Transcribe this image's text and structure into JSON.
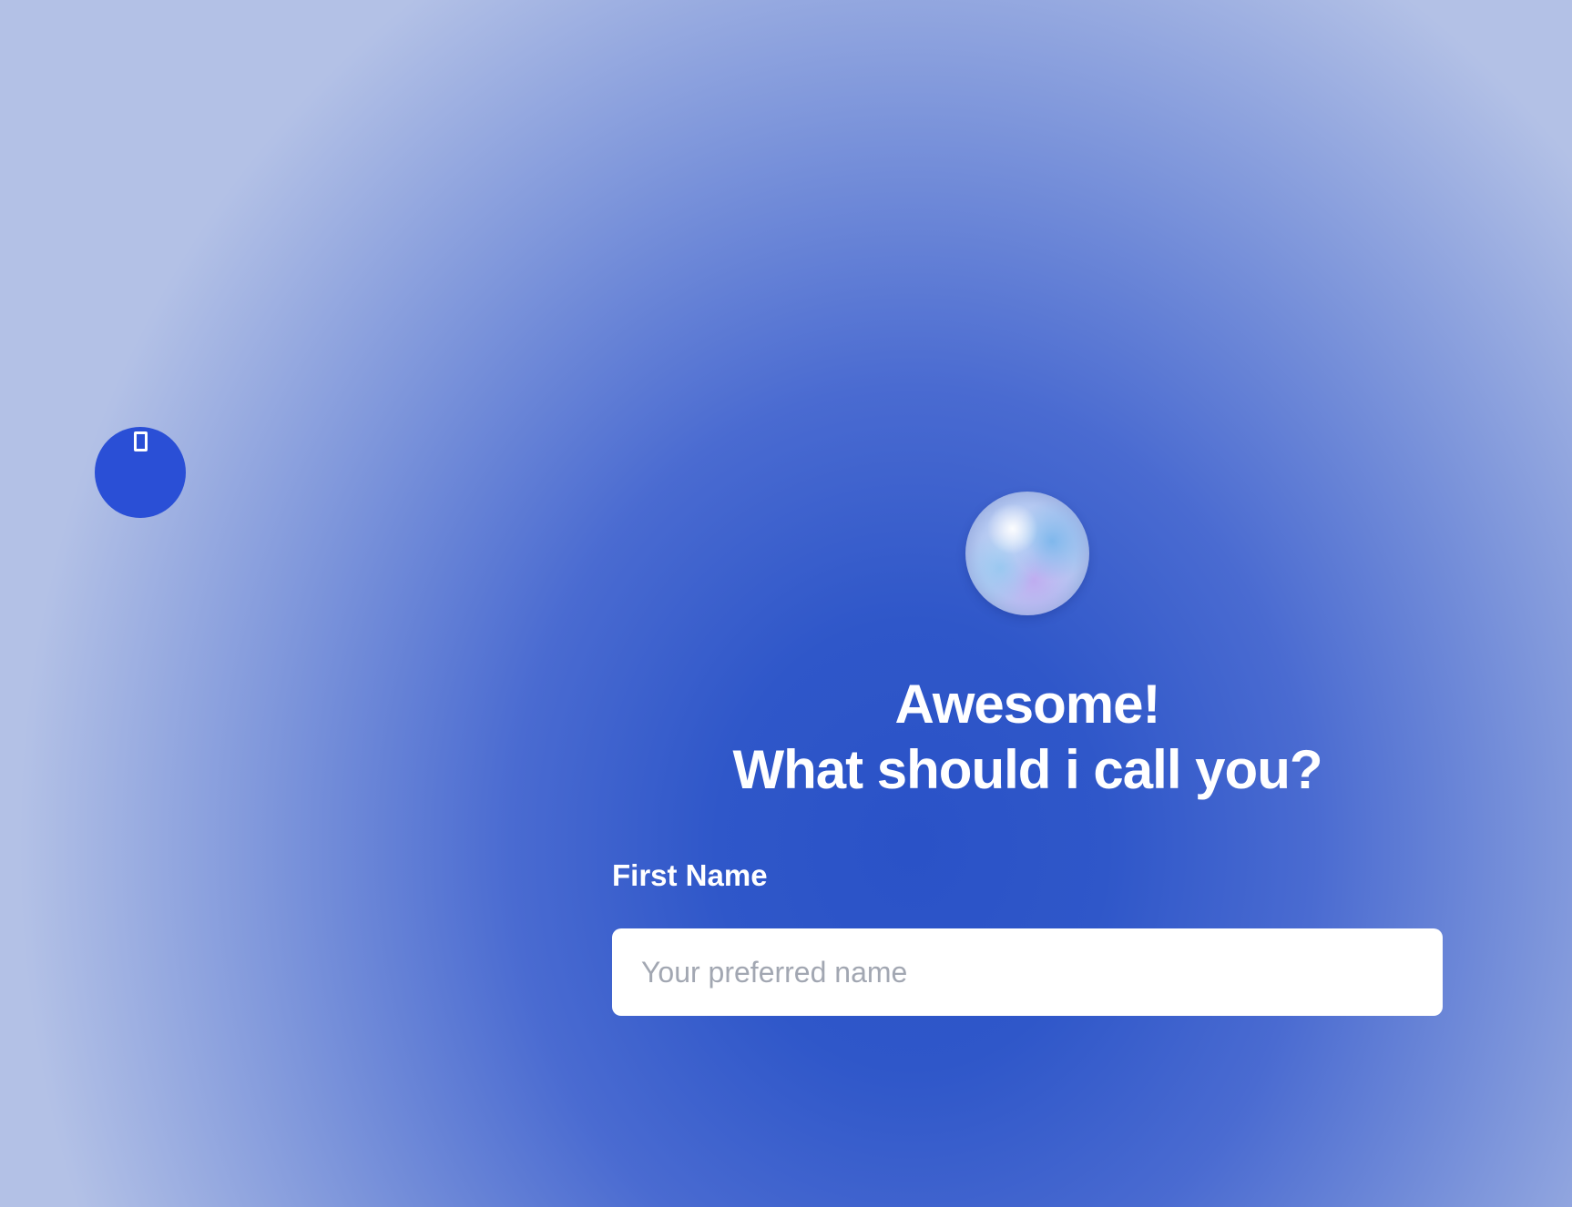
{
  "side_button": {
    "icon": "square-outline-icon"
  },
  "avatar": {
    "icon": "gradient-orb-avatar"
  },
  "heading": {
    "line1": "Awesome!",
    "line2": "What should i call you?"
  },
  "form": {
    "first_name_label": "First Name",
    "first_name_value": "",
    "first_name_placeholder": "Your preferred name"
  },
  "colors": {
    "background_center": "#2a52c7",
    "background_edge": "#b3c1e6",
    "side_button": "#2a4fd6",
    "text": "#ffffff",
    "placeholder": "#a2a7b2"
  }
}
